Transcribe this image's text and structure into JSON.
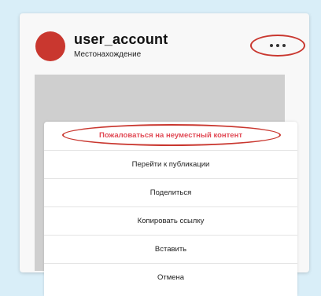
{
  "post": {
    "username": "user_account",
    "location": "Местонахождение"
  },
  "icons": {
    "more": "more-horizontal-icon"
  },
  "menu": {
    "items": [
      {
        "label": "Пожаловаться на неуместный контент"
      },
      {
        "label": "Перейти к публикации"
      },
      {
        "label": "Поделиться"
      },
      {
        "label": "Копировать ссылку"
      },
      {
        "label": "Вставить"
      },
      {
        "label": "Отмена"
      }
    ]
  },
  "colors": {
    "accent": "#c9372f",
    "report_text": "#e14a55",
    "background": "#d9eef8"
  }
}
